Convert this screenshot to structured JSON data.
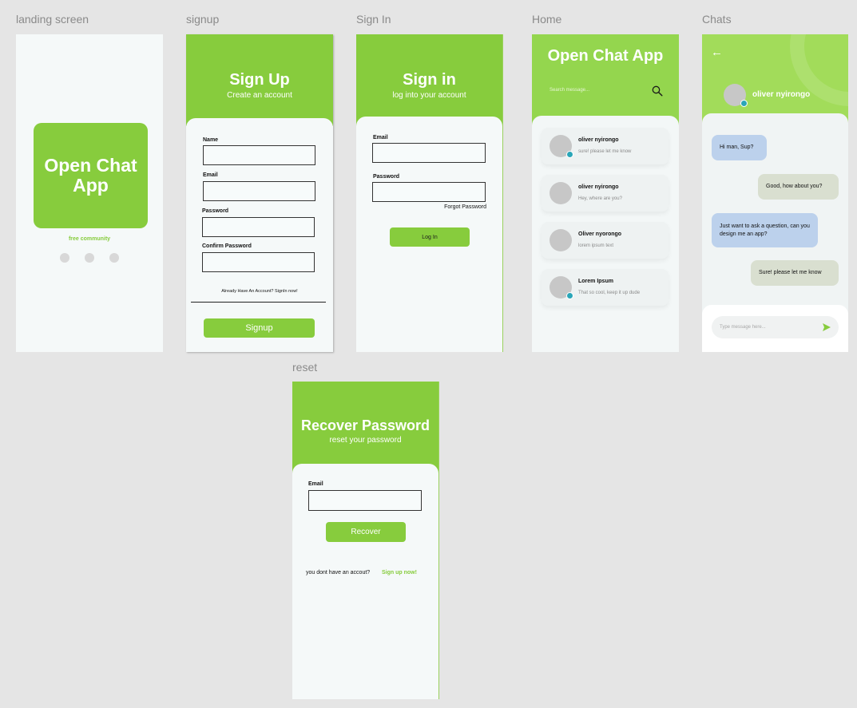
{
  "labels": {
    "landing": "landing screen",
    "signup": "signup",
    "signin": "Sign In",
    "home": "Home",
    "chats": "Chats",
    "reset": "reset"
  },
  "landing": {
    "logo_text": "Open Chat App",
    "tagline": "free community"
  },
  "signup": {
    "title": "Sign Up",
    "subtitle": "Create an account",
    "fields": [
      "Name",
      "Email",
      "Password",
      "Confirm Password"
    ],
    "signin_prompt": "Already Have An Account? SignIn now!",
    "button": "Signup"
  },
  "signin": {
    "title": "Sign in",
    "subtitle": "log into your account",
    "email_label": "Email",
    "password_label": "Password",
    "forgot": "Forgot Password",
    "button": "Log In"
  },
  "home": {
    "title": "Open Chat App",
    "search_placeholder": "Search message...",
    "chats": [
      {
        "name": "oliver nyirongo",
        "message": "sure! please let me know",
        "online": true
      },
      {
        "name": "oliver nyirongo",
        "message": "Hey, where are you?",
        "online": false
      },
      {
        "name": "Oliver nyorongo",
        "message": "lorem ipsum text",
        "online": false
      },
      {
        "name": "Lorem Ipsum",
        "message": "That so cool, keep it up dude",
        "online": true
      }
    ]
  },
  "chats": {
    "back_arrow": "←",
    "contact_name": "oliver nyirongo",
    "messages": [
      {
        "text": "Hi man, Sup?",
        "side": "in"
      },
      {
        "text": "Good, how about you?",
        "side": "out"
      },
      {
        "text": "Just want to ask a question, can you design me an app?",
        "side": "in"
      },
      {
        "text": "Sure! please let me know",
        "side": "out"
      }
    ],
    "input_placeholder": "Type message here..."
  },
  "reset": {
    "title": "Recover Password",
    "subtitle": "reset your password",
    "email_label": "Email",
    "button": "Recover",
    "signup_prompt": "you dont have an accout?",
    "signup_link": "Sign up now!"
  },
  "colors": {
    "brand_green": "#87cc3d",
    "home_green": "#94d64e",
    "online_dot": "#2aa6b8",
    "incoming_bubble": "#bcd1ec",
    "outgoing_bubble": "#d9dfd0"
  },
  "icons": [
    "search-icon",
    "back-arrow-icon",
    "send-icon",
    "online-indicator-icon"
  ]
}
